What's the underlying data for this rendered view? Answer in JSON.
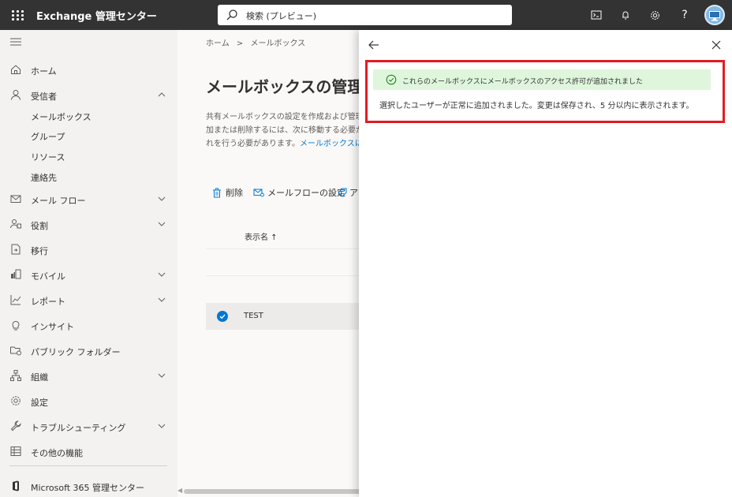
{
  "app": {
    "title": "Exchange 管理センター",
    "search_placeholder": "検索 (プレビュー)",
    "top_icons": [
      "terminal-icon",
      "bell-icon",
      "gear-icon",
      "help-icon",
      "avatar"
    ]
  },
  "leftnav": {
    "items": [
      {
        "label": "ホーム",
        "icon": "home-icon",
        "chevron": false
      },
      {
        "label": "受信者",
        "icon": "person-icon",
        "chevron": "up"
      },
      {
        "label": "メール フロー",
        "icon": "mail-icon",
        "chevron": "down"
      },
      {
        "label": "役割",
        "icon": "roles-icon",
        "chevron": "down"
      },
      {
        "label": "移行",
        "icon": "migration-icon",
        "chevron": false
      },
      {
        "label": "モバイル",
        "icon": "mobile-icon",
        "chevron": "down"
      },
      {
        "label": "レポート",
        "icon": "chart-icon",
        "chevron": "down"
      },
      {
        "label": "インサイト",
        "icon": "lightbulb-icon",
        "chevron": false
      },
      {
        "label": "パブリック フォルダー",
        "icon": "public-folder-icon",
        "chevron": false
      },
      {
        "label": "組織",
        "icon": "org-icon",
        "chevron": "down"
      },
      {
        "label": "設定",
        "icon": "settings-icon",
        "chevron": false
      },
      {
        "label": "トラブルシューティング",
        "icon": "wrench-icon",
        "chevron": "down"
      },
      {
        "label": "その他の機能",
        "icon": "grid-icon",
        "chevron": false
      }
    ],
    "sub_items": [
      "メールボックス",
      "グループ",
      "リソース",
      "連絡先"
    ],
    "footer": {
      "label": "Microsoft 365 管理センター",
      "icon": "office-icon"
    }
  },
  "main": {
    "breadcrumb": [
      "ホーム",
      "メールボックス"
    ],
    "breadcrumb_sep": ">",
    "title": "メールボックスの管理",
    "desc_lines": [
      "共有メールボックスの設定を作成および管理",
      "加または削除するには、次に移動する必要が",
      "れを行う必要があります。"
    ],
    "desc_link": "メールボックスに関",
    "commands": [
      {
        "label": "削除",
        "icon": "trash-icon"
      },
      {
        "label": "メールフローの設定",
        "icon": "mail-settings-icon"
      },
      {
        "label": "ア",
        "icon": "tag-icon"
      }
    ],
    "column_header": "表示名 ↑",
    "rows": [
      {
        "name": "TEST",
        "selected": true
      }
    ]
  },
  "panel": {
    "success_message": "これらのメールボックスにメールボックスのアクセス許可が追加されました",
    "body_text": "選択したユーザーが正常に追加されました。変更は保存され、5 分以内に表示されます。"
  },
  "colors": {
    "topbar": "#333333",
    "accent": "#0078d4",
    "success_bg": "#dff6dd",
    "highlight": "#e21b23"
  }
}
